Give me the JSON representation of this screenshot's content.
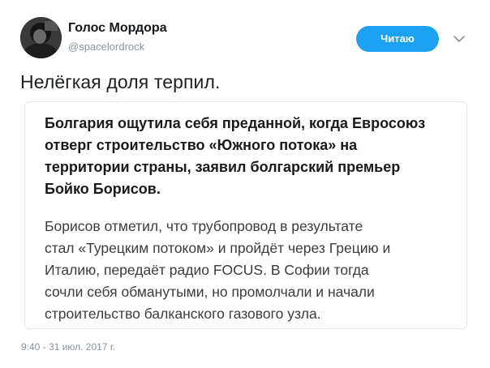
{
  "author": {
    "name": "Голос Мордора",
    "handle": "@spacelordrock"
  },
  "follow_button": {
    "label": "Читаю",
    "color": "#1da1f2"
  },
  "menu_icon": "chevron-down-icon",
  "tweet": {
    "text": "Нелёгкая доля терпил."
  },
  "quote": {
    "headline_lines": [
      "Болгария ощутила себя преданной, когда Евросоюз",
      "отверг строительство «Южного потока» на",
      "территории страны, заявил болгарский премьер",
      "Бойко Борисов."
    ],
    "body_lines": [
      "Борисов отметил, что трубопровод в результате",
      "стал «Турецким потоком» и пройдёт через Грецию и",
      "Италию, передаёт радио FOCUS. В Софии тогда",
      "сочли себя обманутыми, но промолчали и начали",
      "строительство балканского газового узла."
    ]
  },
  "timestamp": "9:40 - 31 июл. 2017 г."
}
